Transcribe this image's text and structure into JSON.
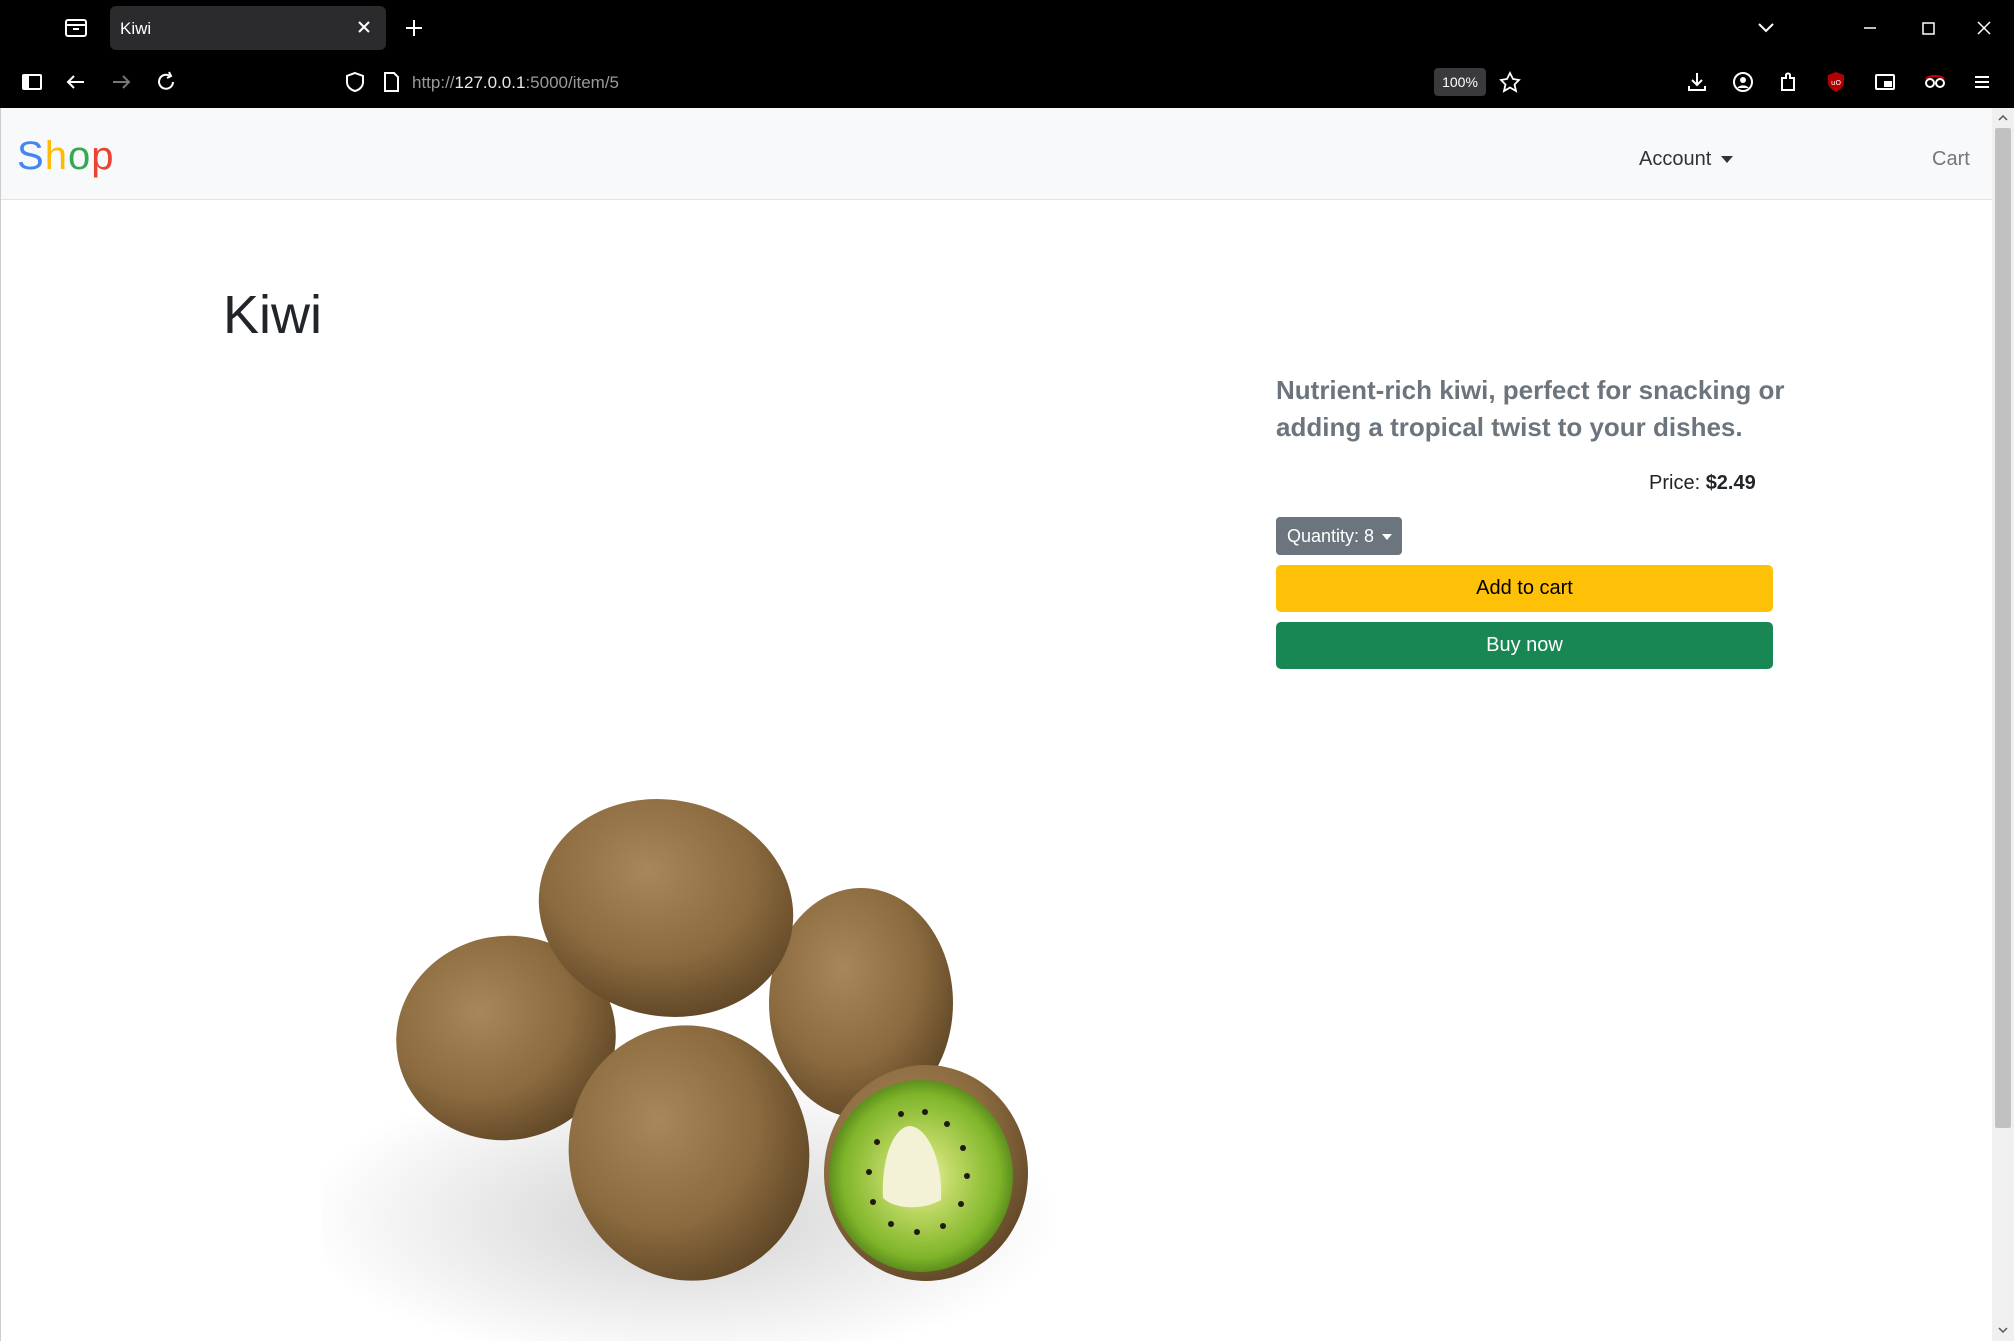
{
  "browser": {
    "tab_title": "Kiwi",
    "url_prefix": "http://",
    "url_host": "127.0.0.1",
    "url_path": ":5000/item/5",
    "zoom": "100%"
  },
  "site": {
    "brand": [
      "S",
      "h",
      "o",
      "p"
    ],
    "nav": {
      "account_label": "Account",
      "cart_label": "Cart"
    }
  },
  "product": {
    "title": "Kiwi",
    "description": "Nutrient-rich kiwi, perfect for snacking or adding a tropical twist to your dishes.",
    "price_label": "Price:",
    "price_value": "$2.49",
    "quantity_label": "Quantity: 8",
    "add_to_cart_label": "Add to cart",
    "buy_now_label": "Buy now"
  },
  "colors": {
    "add_to_cart": "#ffc107",
    "buy_now": "#198754",
    "quantity": "#6c757d"
  }
}
